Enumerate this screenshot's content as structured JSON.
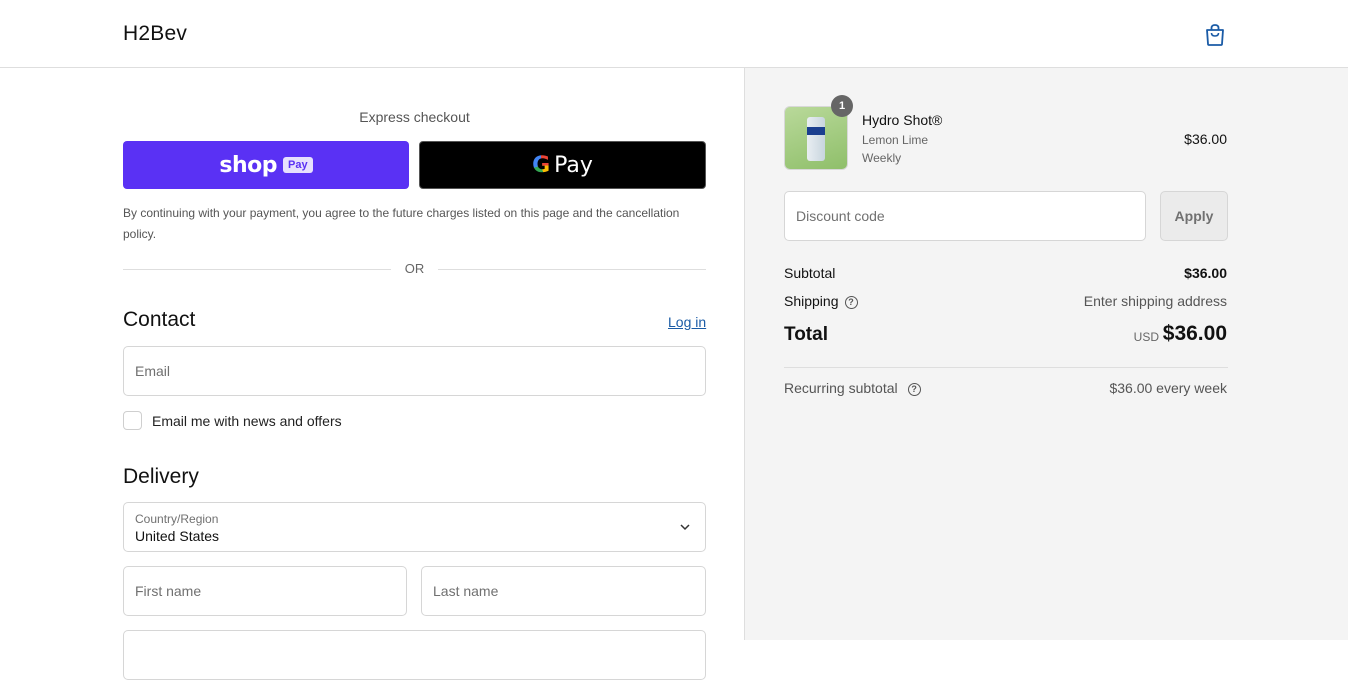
{
  "header": {
    "brand": "H2Bev",
    "cart_icon": "shopping-bag-icon"
  },
  "express": {
    "label": "Express checkout",
    "shop_pay": {
      "word": "shop",
      "badge": "Pay",
      "color": "#5a31f4"
    },
    "google_pay": {
      "g": "G",
      "word": "Pay"
    },
    "consent": "By continuing with your payment, you agree to the future charges listed on this page and the cancellation policy.",
    "or": "OR"
  },
  "contact": {
    "title": "Contact",
    "login": "Log in",
    "email_placeholder": "Email",
    "newsletter_label": "Email me with news and offers"
  },
  "delivery": {
    "title": "Delivery",
    "country_label": "Country/Region",
    "country_value": "United States",
    "first_name_placeholder": "First name",
    "last_name_placeholder": "Last name"
  },
  "order": {
    "item": {
      "quantity": "1",
      "name": "Hydro Shot®",
      "variant": "Lemon Lime",
      "frequency": "Weekly",
      "price": "$36.00"
    },
    "discount_placeholder": "Discount code",
    "apply_label": "Apply",
    "subtotal_label": "Subtotal",
    "subtotal_value": "$36.00",
    "shipping_label": "Shipping",
    "shipping_value": "Enter shipping address",
    "total_label": "Total",
    "total_currency": "USD",
    "total_value": "$36.00",
    "recurring_label": "Recurring subtotal",
    "recurring_value": "$36.00 every week"
  },
  "colors": {
    "link": "#1a5ba6",
    "summary_bg": "#f4f4f4"
  }
}
